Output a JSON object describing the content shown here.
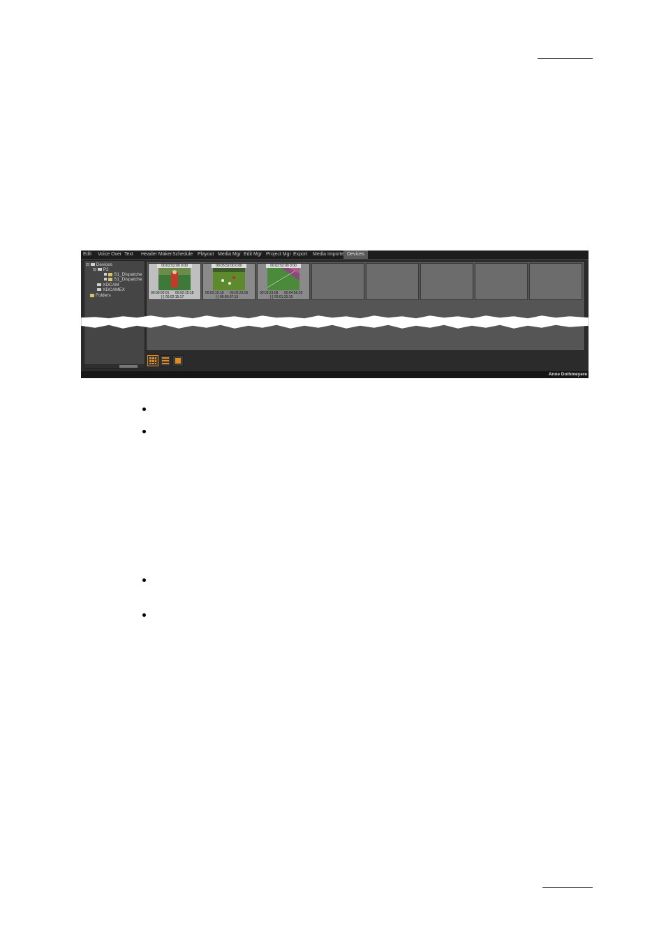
{
  "app": {
    "tabs": [
      "Edit",
      "Voice Over",
      "Text",
      "Header Maker",
      "Schedule",
      "Playout",
      "Media Mgr",
      "Edit Mgr",
      "Project Mgr",
      "Export",
      "Media Importer",
      "Devices"
    ],
    "active_tab": "Devices",
    "tree": {
      "root": "Devices",
      "p2": "P2",
      "item1": "S1_Dispatche",
      "item2": "S1_Dispatche",
      "xdcam": "XDCAM",
      "xdcamex": "XDCAMEX",
      "folders": "Folders"
    },
    "clips": [
      {
        "head": "00:02:52:00 0:00",
        "tc_in": "00:00:00:01",
        "tc_out": "00:02:15:18",
        "dur": "[-] 00:02:15:17"
      },
      {
        "head": "00:05:52:00 0:00",
        "tc_in": "00:02:15:18",
        "tc_out": "00:02:23:05",
        "dur": "[-] 00:00:07:15"
      },
      {
        "head": "00:02:52:00 0:00",
        "tc_in": "00:03:23:08",
        "tc_out": "00:04:56:23",
        "dur": "[-] 00:01:33:15"
      }
    ],
    "status_user": "Anne Dolhmeyere"
  },
  "colors": {
    "accent": "#e38a1c",
    "panel": "#555555",
    "tab_active": "#5a5a5a"
  },
  "icons": [
    "grid-view-icon",
    "list-view-icon",
    "single-view-icon",
    "device-icon",
    "folder-icon"
  ]
}
